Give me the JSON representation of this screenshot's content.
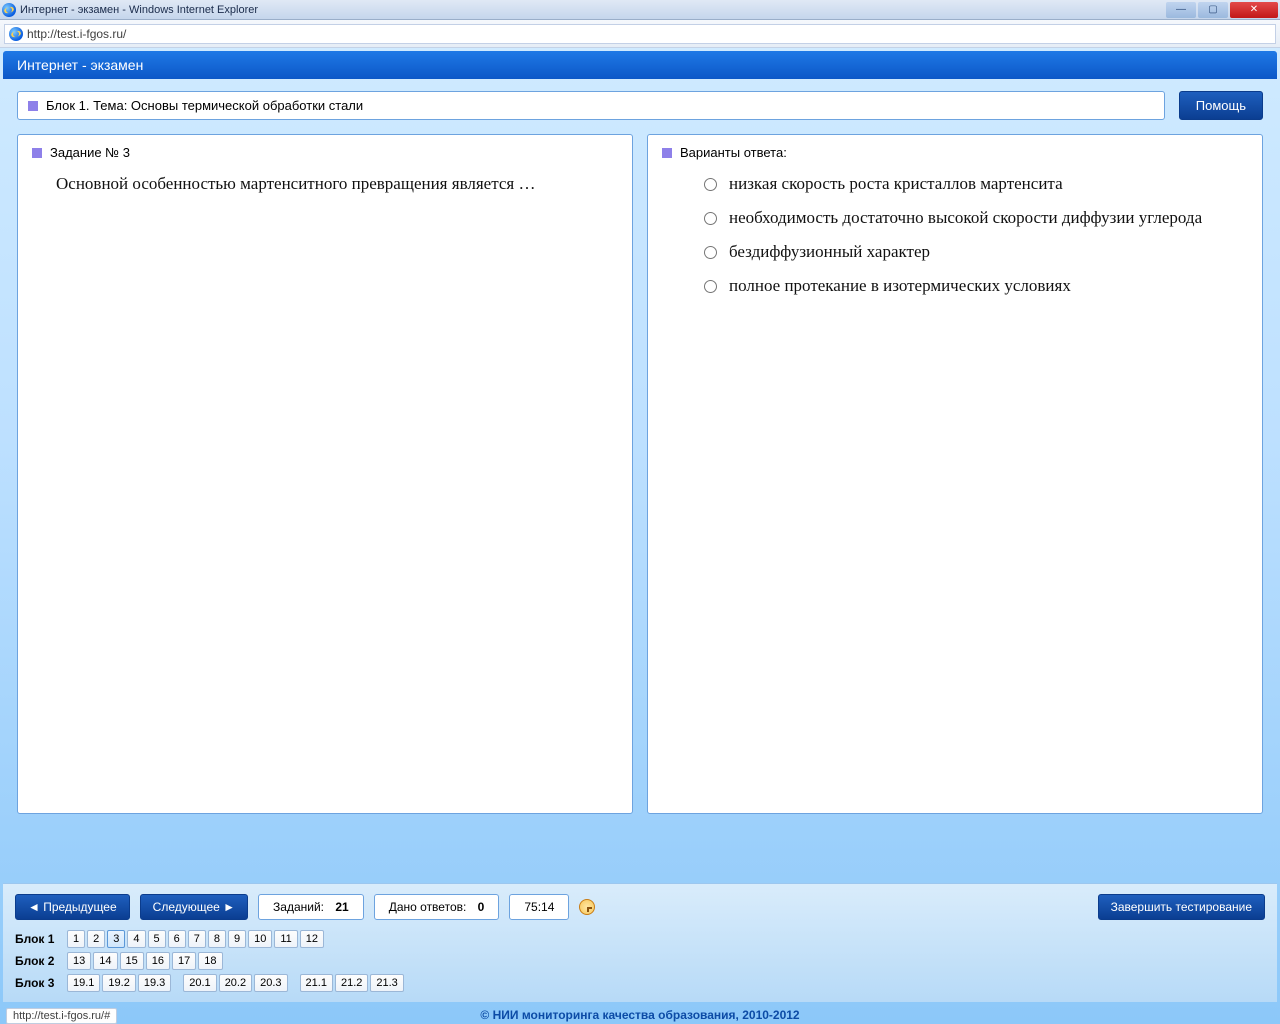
{
  "window": {
    "title": "Интернет - экзамен - Windows Internet Explorer",
    "url": "http://test.i-fgos.ru/",
    "status_url": "http://test.i-fgos.ru/#"
  },
  "app": {
    "header": "Интернет - экзамен",
    "topic": "Блок 1. Тема: Основы термической обработки стали",
    "help_button": "Помощь"
  },
  "question": {
    "panel_title": "Задание № 3",
    "text": "Основной особенностью мартенситного превращения является …"
  },
  "answers": {
    "panel_title": "Варианты ответа:",
    "options": [
      "низкая скорость роста кристаллов мартенсита",
      "необходимость достаточно высокой скорости диффузии углерода",
      "бездиффузионный характер",
      "полное протекание в изотермических условиях"
    ]
  },
  "nav": {
    "prev": "Предыдущее",
    "next": "Следующее",
    "tasks_label": "Заданий:",
    "tasks_count": "21",
    "answered_label": "Дано ответов:",
    "answered_count": "0",
    "time": "75:14",
    "finish": "Завершить тестирование"
  },
  "blocks": [
    {
      "label": "Блок 1",
      "items": [
        "1",
        "2",
        "3",
        "4",
        "5",
        "6",
        "7",
        "8",
        "9",
        "10",
        "11",
        "12"
      ],
      "active_index": 2
    },
    {
      "label": "Блок 2",
      "items": [
        "13",
        "14",
        "15",
        "16",
        "17",
        "18"
      ],
      "active_index": -1
    },
    {
      "label": "Блок 3",
      "items": [
        "19.1",
        "19.2",
        "19.3",
        "20.1",
        "20.2",
        "20.3",
        "21.1",
        "21.2",
        "21.3"
      ],
      "active_index": -1,
      "gap_after": 2
    }
  ],
  "footer": {
    "copyright": "© НИИ мониторинга качества образования, 2010-2012"
  }
}
